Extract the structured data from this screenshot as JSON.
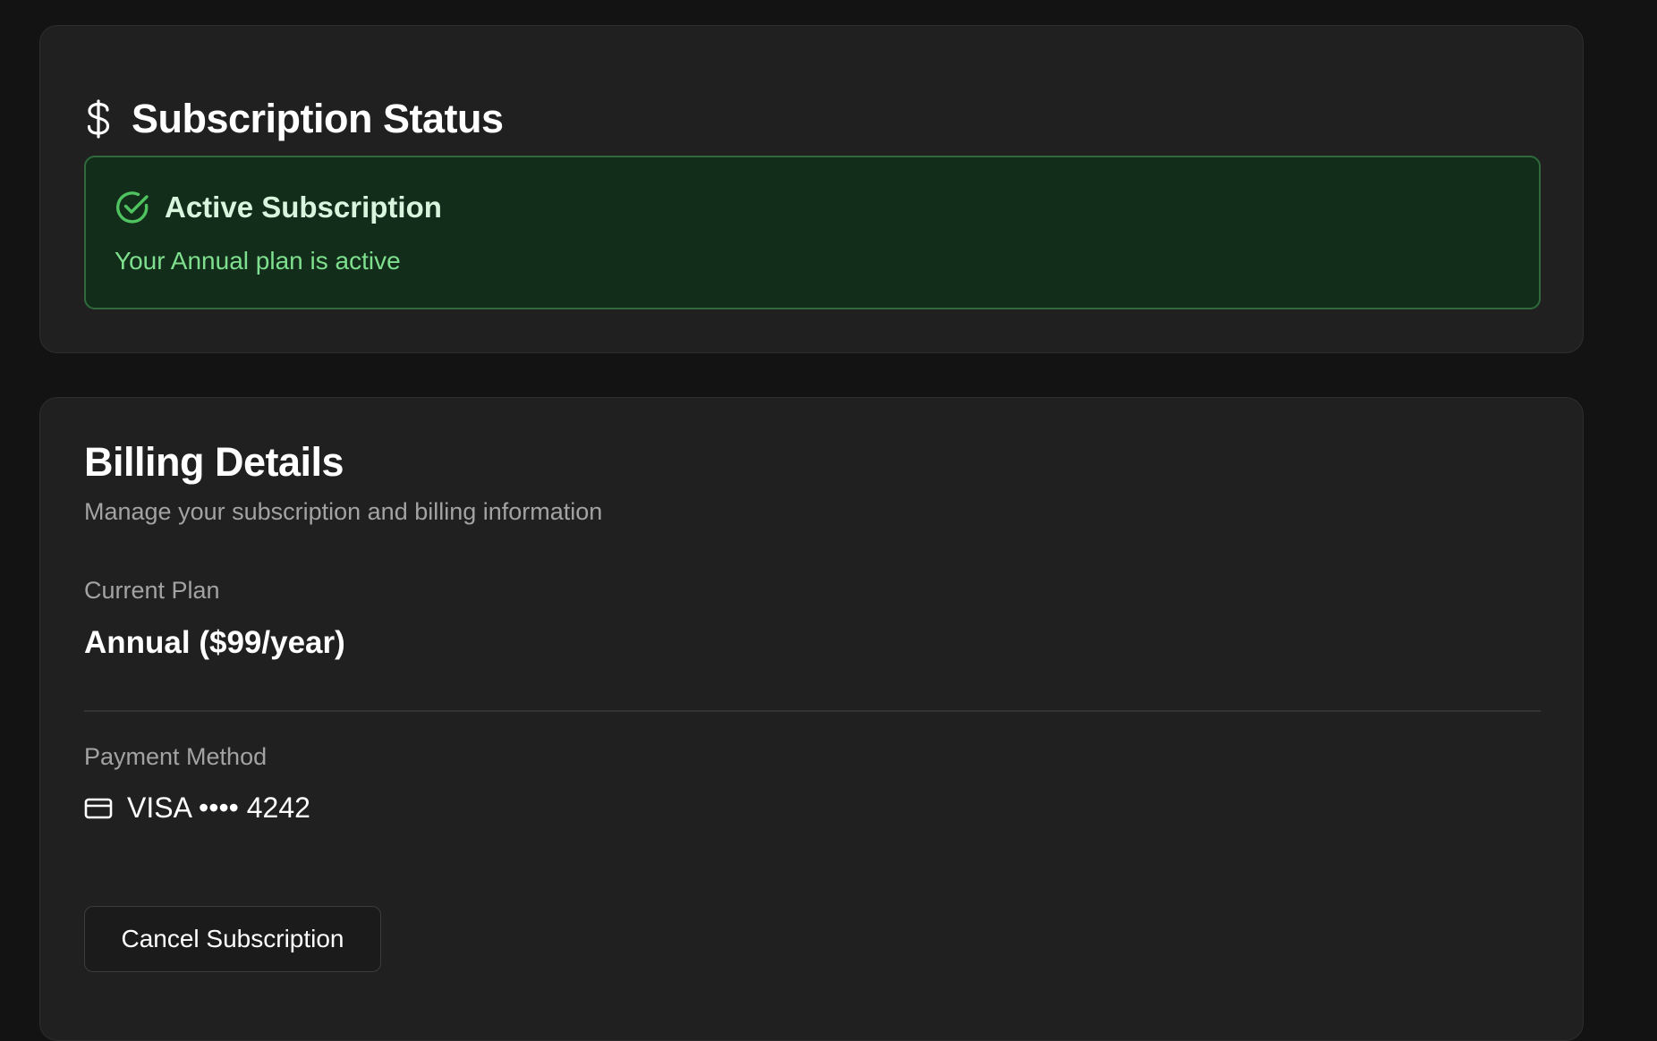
{
  "subscription_status": {
    "title": "Subscription Status",
    "icon": "dollar-icon",
    "status_box": {
      "icon": "check-circle-icon",
      "title": "Active Subscription",
      "description": "Your Annual plan is active"
    }
  },
  "billing": {
    "title": "Billing Details",
    "subtitle": "Manage your subscription and billing information",
    "current_plan_label": "Current Plan",
    "current_plan_value": "Annual ($99/year)",
    "payment_method_label": "Payment Method",
    "payment_method_icon": "credit-card-icon",
    "payment_method_value": "VISA •••• 4242",
    "cancel_button_label": "Cancel Subscription"
  },
  "colors": {
    "page_background": "#131313",
    "card_background": "#202020",
    "success_background": "#132d1b",
    "success_border": "#2e6a3b",
    "success_text": "#7ee08e",
    "success_icon": "#4ec35f",
    "muted_text": "#a3a3a3"
  }
}
